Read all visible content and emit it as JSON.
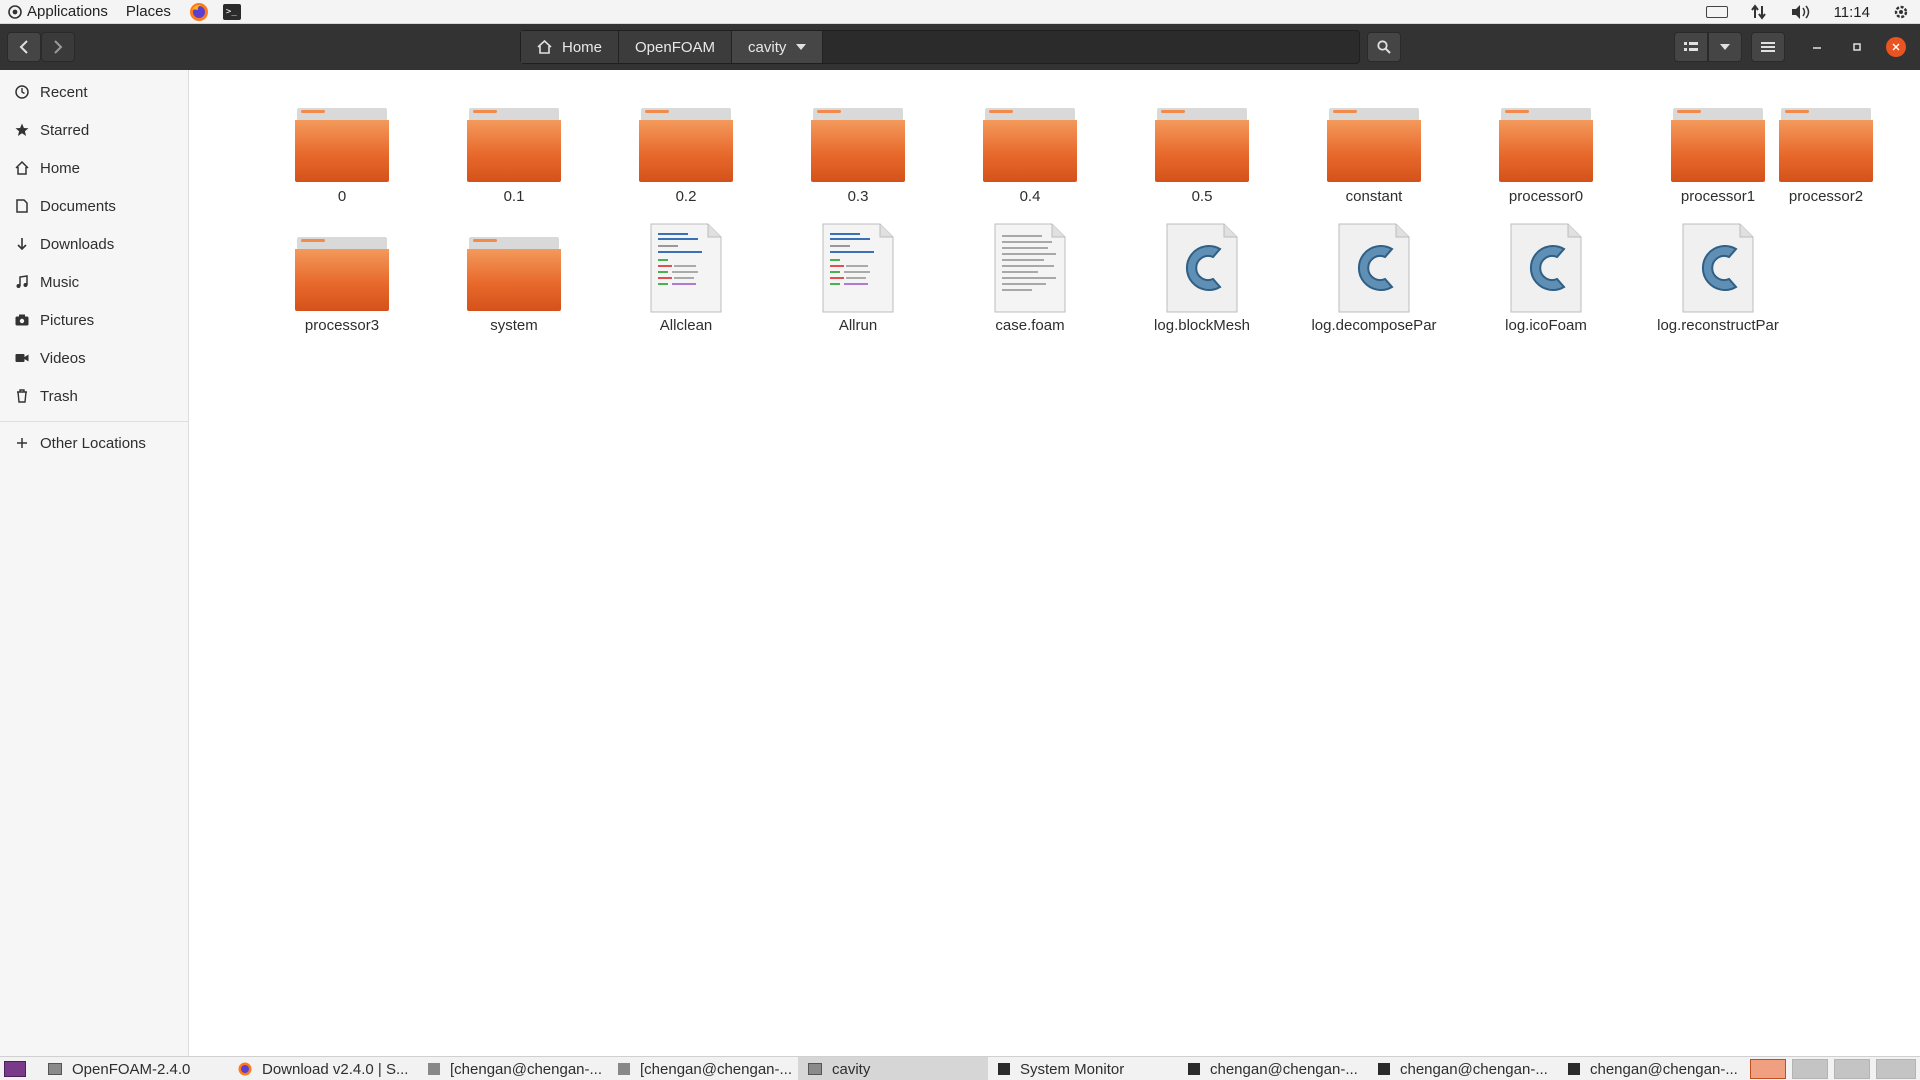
{
  "top_panel": {
    "applications": "Applications",
    "places": "Places",
    "clock": "11:14"
  },
  "header": {
    "crumbs": [
      "Home",
      "OpenFOAM",
      "cavity"
    ]
  },
  "sidebar": {
    "items": [
      "Recent",
      "Starred",
      "Home",
      "Documents",
      "Downloads",
      "Music",
      "Pictures",
      "Videos",
      "Trash"
    ],
    "other": "Other Locations"
  },
  "files": {
    "row1": [
      "0",
      "0.1",
      "0.2",
      "0.3",
      "0.4",
      "0.5",
      "constant",
      "processor0",
      "processor1",
      "processor2"
    ],
    "row2": [
      "processor3",
      "system",
      "Allclean",
      "Allrun",
      "case.foam",
      "log.blockMesh",
      "log.decomposePar",
      "log.icoFoam",
      "log.reconstructPar"
    ]
  },
  "taskbar": {
    "items": [
      "OpenFOAM-2.4.0",
      "Download v2.4.0 | S...",
      "[chengan@chengan-...",
      "[chengan@chengan-...",
      "cavity",
      "System Monitor",
      "chengan@chengan-...",
      "chengan@chengan-...",
      "chengan@chengan-..."
    ]
  },
  "colors": {
    "folder_orange": "#e2591e",
    "header_bg": "#333333",
    "close_red": "#e95420"
  }
}
